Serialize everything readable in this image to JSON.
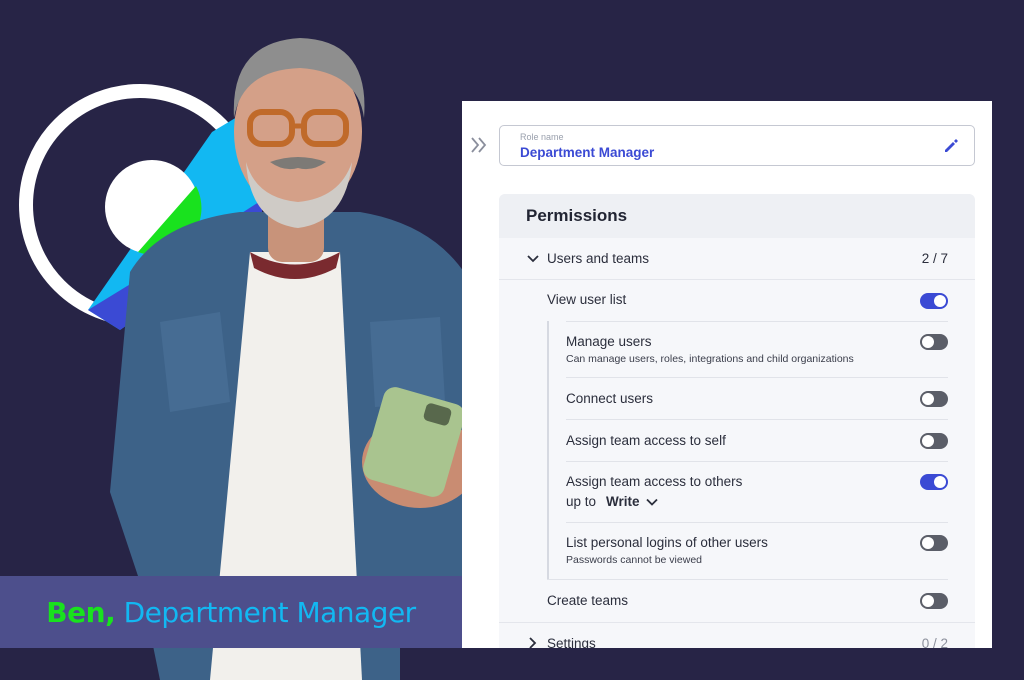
{
  "banner": {
    "name": "Ben,",
    "role": "Department Manager"
  },
  "role": {
    "label": "Role name",
    "value": "Department Manager"
  },
  "permissions": {
    "title": "Permissions",
    "sections": [
      {
        "label": "Users and teams",
        "count": "2 / 7",
        "expanded": true
      },
      {
        "label": "Settings",
        "count": "0 / 2",
        "expanded": false
      }
    ],
    "items": [
      {
        "label": "View user list",
        "on": true
      },
      {
        "label": "Manage users",
        "desc": "Can manage users, roles, integrations and child organizations",
        "on": false
      },
      {
        "label": "Connect users",
        "on": false
      },
      {
        "label": "Assign team access to self",
        "on": false
      },
      {
        "label": "Assign team access to others",
        "upto": "up to",
        "level": "Write",
        "on": true
      },
      {
        "label": "List personal logins of other users",
        "desc": "Passwords cannot be viewed",
        "on": false
      },
      {
        "label": "Create teams",
        "on": false
      }
    ]
  },
  "colors": {
    "accent": "#3b4ad4",
    "background": "#272446",
    "banner_bg": "#4d4f8c",
    "banner_name": "#19e21e",
    "banner_role": "#12b8f2"
  },
  "icons": {
    "collapse": "double-chevron-right-icon",
    "edit": "pencil-icon"
  }
}
